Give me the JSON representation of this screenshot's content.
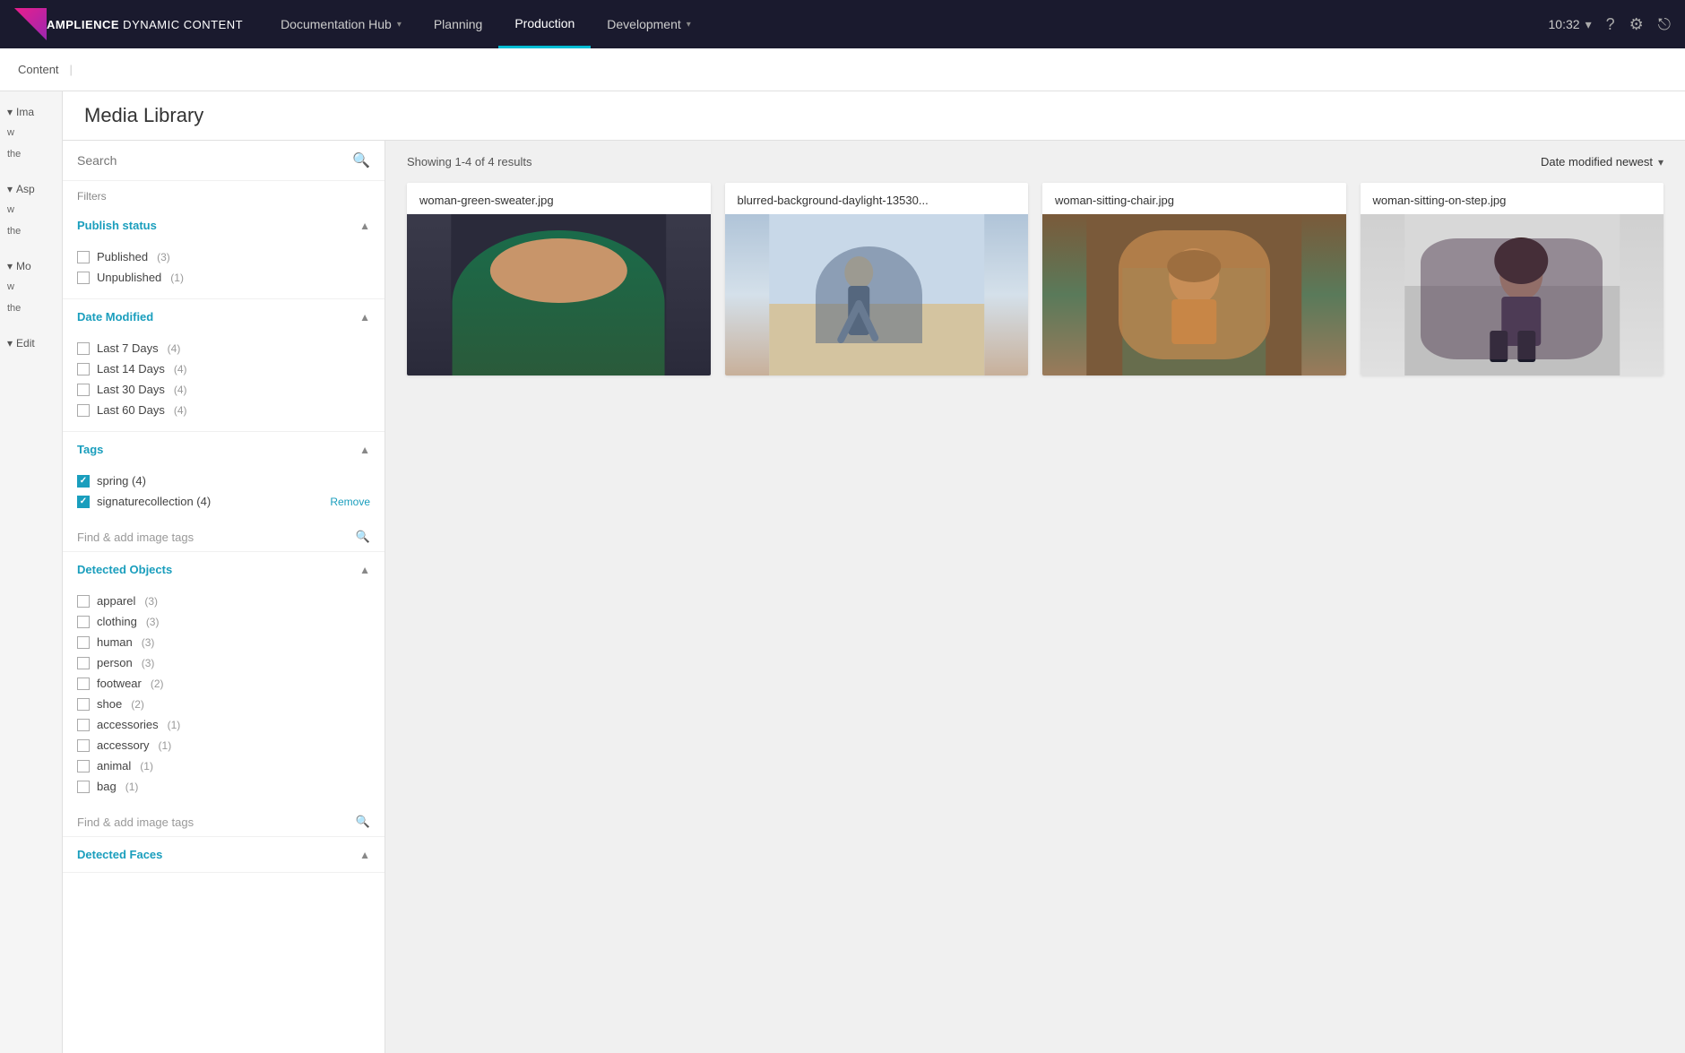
{
  "brand": {
    "name_bold": "AMPLIENCE",
    "name_light": " DYNAMIC CONTENT"
  },
  "nav": {
    "items": [
      {
        "label": "Documentation Hub",
        "has_chevron": true,
        "active": false
      },
      {
        "label": "Planning",
        "has_chevron": false,
        "active": false
      },
      {
        "label": "Production",
        "has_chevron": false,
        "active": true
      },
      {
        "label": "Development",
        "has_chevron": true,
        "active": false
      }
    ],
    "time": "10:32",
    "icons": [
      "chevron-down",
      "question",
      "settings",
      "export"
    ]
  },
  "second_bar": {
    "label": "Content"
  },
  "page": {
    "title": "Media Library"
  },
  "search": {
    "placeholder": "Search"
  },
  "filters": {
    "label": "Filters",
    "sections": [
      {
        "id": "publish_status",
        "title": "Publish status",
        "expanded": true,
        "options": [
          {
            "label": "Published",
            "count": "(3)",
            "checked": false
          },
          {
            "label": "Unpublished",
            "count": "(1)",
            "checked": false
          }
        ]
      },
      {
        "id": "date_modified",
        "title": "Date Modified",
        "expanded": true,
        "options": [
          {
            "label": "Last 7 Days",
            "count": "(4)",
            "checked": false
          },
          {
            "label": "Last 14 Days",
            "count": "(4)",
            "checked": false
          },
          {
            "label": "Last 30 Days",
            "count": "(4)",
            "checked": false
          },
          {
            "label": "Last 60 Days",
            "count": "(4)",
            "checked": false
          }
        ]
      },
      {
        "id": "tags",
        "title": "Tags",
        "expanded": true,
        "tags": [
          {
            "label": "spring (4)",
            "checked": true
          },
          {
            "label": "signaturecollection (4)",
            "checked": true,
            "remove": "Remove"
          }
        ],
        "find_placeholder": "Find & add image tags"
      },
      {
        "id": "detected_objects",
        "title": "Detected Objects",
        "expanded": true,
        "options": [
          {
            "label": "apparel",
            "count": "(3)",
            "checked": false
          },
          {
            "label": "clothing",
            "count": "(3)",
            "checked": false
          },
          {
            "label": "human",
            "count": "(3)",
            "checked": false
          },
          {
            "label": "person",
            "count": "(3)",
            "checked": false
          },
          {
            "label": "footwear",
            "count": "(2)",
            "checked": false
          },
          {
            "label": "shoe",
            "count": "(2)",
            "checked": false
          },
          {
            "label": "accessories",
            "count": "(1)",
            "checked": false
          },
          {
            "label": "accessory",
            "count": "(1)",
            "checked": false
          },
          {
            "label": "animal",
            "count": "(1)",
            "checked": false
          },
          {
            "label": "bag",
            "count": "(1)",
            "checked": false
          }
        ],
        "find_placeholder": "Find & add image tags"
      },
      {
        "id": "detected_faces",
        "title": "Detected Faces",
        "expanded": true,
        "options": []
      }
    ]
  },
  "grid": {
    "results_text": "Showing 1-4 of 4 results",
    "sort_label": "Date modified newest",
    "items": [
      {
        "filename": "woman-green-sweater.jpg",
        "img_class": "img-woman-green"
      },
      {
        "filename": "blurred-background-daylight-13530...",
        "img_class": "img-blurred"
      },
      {
        "filename": "woman-sitting-chair.jpg",
        "img_class": "img-sitting-chair"
      },
      {
        "filename": "woman-sitting-on-step.jpg",
        "img_class": "img-sitting-step"
      }
    ]
  },
  "left_sidebar": {
    "sections": [
      {
        "label": "Ima",
        "items": [
          "w",
          "the"
        ]
      },
      {
        "label": "Asp",
        "items": [
          "w",
          "the"
        ]
      },
      {
        "label": "Mo",
        "items": [
          "w",
          "the"
        ]
      },
      {
        "label": "Edit",
        "items": []
      }
    ]
  }
}
